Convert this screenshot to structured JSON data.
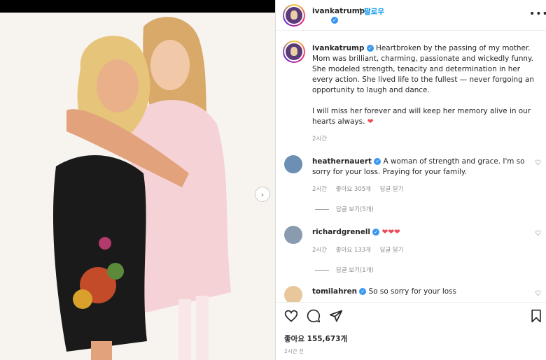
{
  "header": {
    "username": "ivankatrump",
    "dot": "•",
    "follow_label": "팔로우",
    "more_label": "•••"
  },
  "post": {
    "caption_user": "ivankatrump",
    "caption_p1": "Heartbroken by the passing of my mother. Mom was brilliant, charming, passionate and wickedly funny. She modeled strength, tenacity and determination in her every action. She lived life to the fullest — never forgoing an opportunity to laugh and dance.",
    "caption_p2": "I will miss her forever and will keep her memory alive in our hearts always.",
    "caption_emoji": "❤",
    "caption_time": "2시간",
    "likes": "좋아요 155,673개",
    "time": "2시간 전"
  },
  "comments": [
    {
      "user": "heathernauert",
      "text": "A woman of strength and grace. I'm so sorry for your loss. Praying for your family.",
      "time": "2시간",
      "likes": "좋아요 305개",
      "reply_label": "답글 달기",
      "view_replies": "답글 보기(5개)"
    },
    {
      "user": "richardgrenell",
      "text": "❤❤❤",
      "time": "2시간",
      "likes": "좋아요 133개",
      "reply_label": "답글 달기",
      "view_replies": "답글 보기(1개)"
    },
    {
      "user": "tomilahren",
      "text": "So so sorry for your loss"
    }
  ],
  "icons": {
    "next": "chevron-right-icon",
    "like": "heart-icon",
    "comment": "comment-icon",
    "share": "paper-plane-icon",
    "save": "bookmark-icon"
  },
  "colors": {
    "link": "#0095f6",
    "verified": "#3897f0",
    "heart": "#ed4956",
    "meta": "#8e8e8e"
  }
}
